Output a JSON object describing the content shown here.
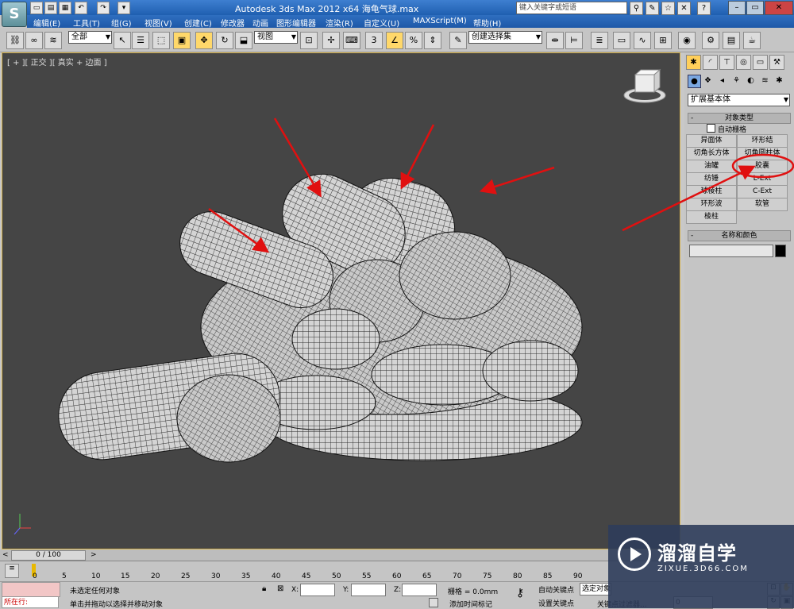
{
  "window": {
    "title": "Autodesk 3ds Max  2012 x64   海龟气球.max",
    "search_placeholder": "键入关键字或短语"
  },
  "app_logo_glyph": "S",
  "menu": [
    "编辑(E)",
    "工具(T)",
    "组(G)",
    "视图(V)",
    "创建(C)",
    "修改器",
    "动画",
    "图形编辑器",
    "渲染(R)",
    "自定义(U)",
    "MAXScript(M)",
    "帮助(H)"
  ],
  "toolbar": {
    "selection_filter": "全部",
    "ref_coord": "视图",
    "named_selection": "创建选择集",
    "snap_label": "3"
  },
  "viewport": {
    "label": "[ + ][ 正交 ][ 真实 + 边面 ]"
  },
  "command_panel": {
    "category": "扩展基本体",
    "object_type_title": "对象类型",
    "autogrid_label": "自动栅格",
    "buttons": [
      "异面体",
      "环形结",
      "切角长方体",
      "切角圆柱体",
      "油罐",
      "胶囊",
      "纺锤",
      "L-Ext",
      "球棱柱",
      "C-Ext",
      "环形波",
      "软管",
      "棱柱"
    ],
    "name_color_title": "名称和颜色"
  },
  "timeline": {
    "frame_counter": "0 / 100",
    "ticks": [
      "0",
      "5",
      "10",
      "15",
      "20",
      "25",
      "30",
      "35",
      "40",
      "45",
      "50",
      "55",
      "60",
      "65",
      "70",
      "75",
      "80",
      "85",
      "90"
    ]
  },
  "status": {
    "running_label": "所在行:",
    "selection_status": "未选定任何对象",
    "prompt": "单击并拖动以选择并移动对象",
    "x_label": "X:",
    "y_label": "Y:",
    "z_label": "Z:",
    "grid_label": "栅格 = 0.0mm",
    "add_time_tag": "添加时间标记",
    "auto_key": "自动关键点",
    "auto_key_mode": "选定对象",
    "set_key": "设置关键点",
    "key_filters": "关键点过滤器...",
    "frame_value": "0"
  },
  "watermark": {
    "brand": "溜溜自学",
    "url": "ZIXUE.3D66.COM"
  },
  "colors": {
    "viewport_bg": "#454545",
    "mesh_fill": "#cfcfcf",
    "wire": "#2a2a2a",
    "arrow": "#e01010",
    "accent_blue": "#1d58a8"
  }
}
